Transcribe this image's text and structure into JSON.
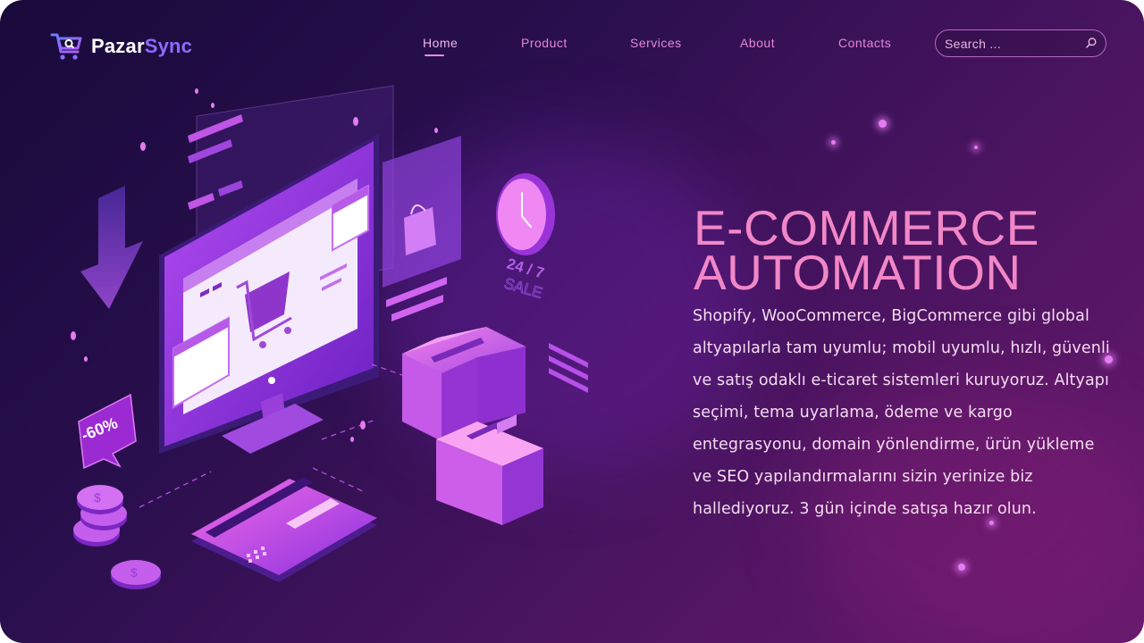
{
  "brand": {
    "name_primary": "Pazar",
    "name_accent": "Sync"
  },
  "nav": {
    "items": [
      {
        "label": "Home",
        "active": true
      },
      {
        "label": "Product",
        "active": false
      },
      {
        "label": "Services",
        "active": false
      },
      {
        "label": "About",
        "active": false
      },
      {
        "label": "Contacts",
        "active": false
      }
    ]
  },
  "search": {
    "placeholder": "Search ..."
  },
  "hero": {
    "title_line1": "E-COMMERCE",
    "title_line2": "AUTOMATION",
    "body": "Shopify, WooCommerce, BigCommerce gibi global altyapılarla tam uyumlu; mobil uyumlu, hızlı, güvenli ve satış odaklı e-ticaret sistemleri kuruyoruz. Altyapı seçimi, tema uyarlama, ödeme ve kargo entegrasyonu, domain yönlendirme, ürün yükleme ve SEO yapılandırmalarını sizin yerinize biz hallediyoruz. 3 gün içinde satışa hazır olun."
  },
  "illustration": {
    "discount_label": "-60%",
    "clock_label_1": "24 / 7",
    "clock_label_2": "SALE"
  },
  "colors": {
    "accent_pink": "#f287c7",
    "accent_purple": "#8c6cff",
    "nav_pink": "#e487d6"
  }
}
